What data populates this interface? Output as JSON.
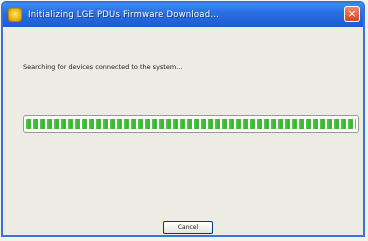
{
  "window": {
    "title": "Initializing LGE PDUs Firmware Download...",
    "close_label": "×"
  },
  "main": {
    "status_text": "Searching for devices connected to the system...",
    "progress": 1.0
  },
  "buttons": {
    "cancel_label": "Cancel"
  },
  "colors": {
    "titlebar": "#2a6fe2",
    "progress_fill": "#52c848",
    "close_button": "#d8431f"
  },
  "icons": {
    "app": "app-icon",
    "close": "close-icon"
  }
}
